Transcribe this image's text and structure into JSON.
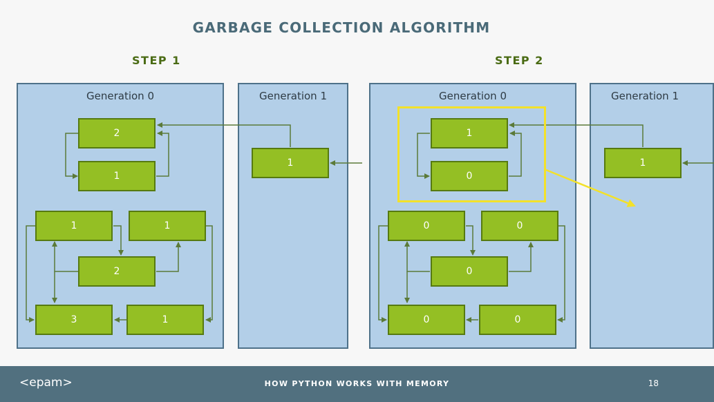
{
  "title": "GARBAGE COLLECTION ALGORITHM",
  "steps": [
    {
      "label": "STEP 1",
      "generation0": {
        "label": "Generation 0",
        "nodes": [
          "2",
          "1",
          "1",
          "1",
          "2",
          "3",
          "1"
        ]
      },
      "generation1": {
        "label": "Generation 1",
        "nodes": [
          "1"
        ]
      }
    },
    {
      "label": "STEP 2",
      "generation0": {
        "label": "Generation 0",
        "nodes": [
          "1",
          "0",
          "0",
          "0",
          "0",
          "0",
          "0"
        ]
      },
      "generation1": {
        "label": "Generation 1",
        "nodes": [
          "1"
        ]
      }
    }
  ],
  "colors": {
    "panel_fill": "#b3cfe8",
    "node_fill": "#94bf24",
    "wire": "#5b7a38",
    "highlight": "#f3e12a",
    "footer": "#51707f"
  },
  "footer": {
    "logo": "<epam>",
    "title": "HOW PYTHON WORKS WITH MEMORY",
    "page": "18"
  }
}
